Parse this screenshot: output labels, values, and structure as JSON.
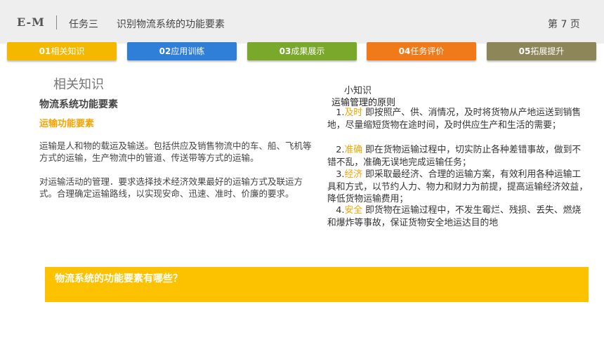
{
  "header": {
    "logo": "E-M",
    "task": "任务三",
    "topic": "识别物流系统的功能要素",
    "page": "第 7 页"
  },
  "tabs": [
    {
      "num": "01",
      "label": "相关知识",
      "color": "#f5b800"
    },
    {
      "num": "02",
      "label": "应用训练",
      "color": "#2f7ed8"
    },
    {
      "num": "03",
      "label": "成果展示",
      "color": "#7aa82a"
    },
    {
      "num": "04",
      "label": "任务评价",
      "color": "#f07a1a"
    },
    {
      "num": "05",
      "label": "拓展提升",
      "color": "#8c8659"
    }
  ],
  "left": {
    "heading": "相关知识",
    "subtitle": "物流系统功能要素",
    "section": "运输功能要素",
    "para1": "运输是人和物的载运及输送。包括供应及销售物流中的车、船、飞机等方式的运输，生产物流中的管道、传送带等方式的运输。",
    "para2": "对运输活动的管理．要求选择技术经济效果最好的运输方式及联运方式。合理确定运输路线，以实现安命、迅速、准时、价廉的要求。"
  },
  "right": {
    "title": "小知识",
    "subtitle": "运输管理的原则",
    "items": [
      {
        "num": "1.",
        "key": "及时",
        "text": " 即按照产、供、消情况，及时将货物从产地运送到销售地，尽量缩短货物在途时间，及时供应生产和生活的需要；"
      },
      {
        "num": "2.",
        "key": "准确",
        "text": " 即在货物运输过程中，切实防止各种差错事故，做到不错不乱，准确无误地完成运输任务；"
      },
      {
        "num": "3.",
        "key": "经济",
        "text": " 即采取最经济、合理的运输方案，有效利用各种运输工具和方式，以节约人力、物力和财力为前提，提高运输经济效益，降低货物运输费用；"
      },
      {
        "num": "4.",
        "key": "安全",
        "text": " 即货物在运输过程中，不发生霉烂、残损、丢失、燃烧和爆炸等事故，保证货物安全地运达目的地"
      }
    ]
  },
  "question": "物流系统的功能要素有哪些？"
}
